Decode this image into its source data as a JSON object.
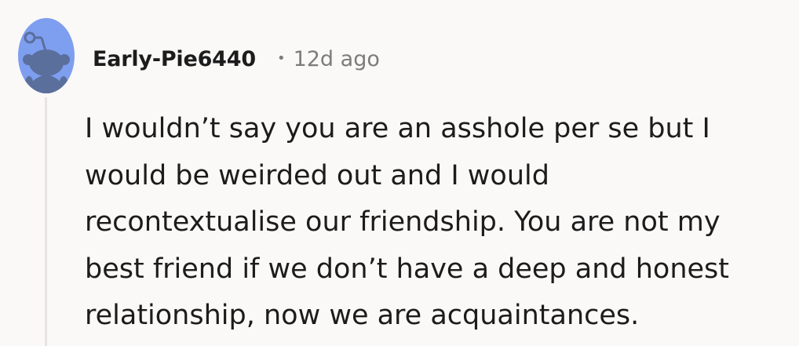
{
  "comment": {
    "author": "Early-Pie6440",
    "separator": "•",
    "age": "12d ago",
    "body_lines": [
      "I wouldn’t say you are an asshole per se but I",
      "would be weirded out and I would",
      "recontextualise our friendship. You are not my",
      "best friend if we don’t have a deep and honest",
      "relationship, now we are acquaintances."
    ],
    "avatar": {
      "icon": "snoo-avatar-icon",
      "background_color": "#7e9ef0",
      "figure_color": "#5a6f9c"
    },
    "colors": {
      "text": "#1c1c1c",
      "muted": "#7c7c7c",
      "thread_line": "#e6e3e1",
      "background": "#fbf9f8"
    }
  }
}
